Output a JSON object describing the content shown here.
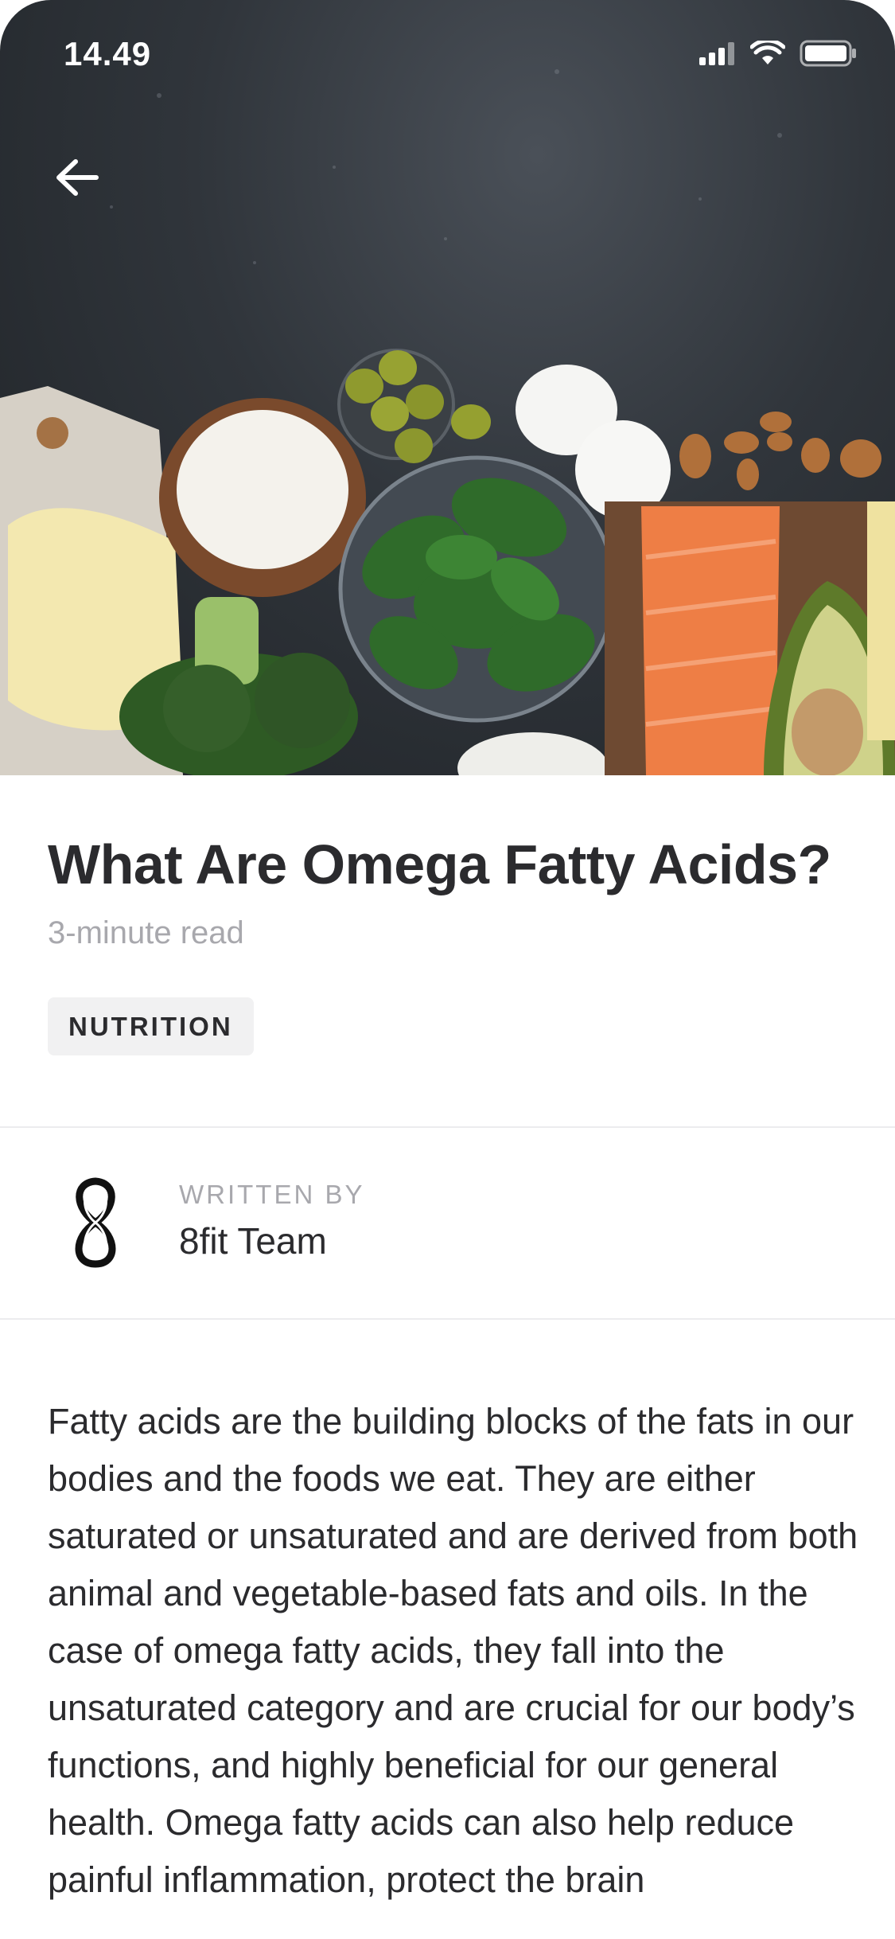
{
  "status_bar": {
    "time": "14.49"
  },
  "article": {
    "title": "What Are Omega Fatty Acids?",
    "read_time": "3-minute read",
    "tag": "NUTRITION",
    "author_label": "WRITTEN BY",
    "author_name": "8fit Team",
    "body": "Fatty acids are the building blocks of the fats in our bodies and the foods we eat. They are either saturated or unsaturated and are derived from both animal and vegetable-based fats and oils. In the case of omega fatty acids, they fall into the unsaturated category and are crucial for our body’s functions, and highly beneficial for our general health. Omega fatty acids can also help reduce painful inflammation, protect the brain"
  },
  "icons": {
    "back": "arrow-left-icon",
    "signal": "signal-icon",
    "wifi": "wifi-icon",
    "battery": "battery-icon",
    "author_logo": "8fit-logo"
  }
}
